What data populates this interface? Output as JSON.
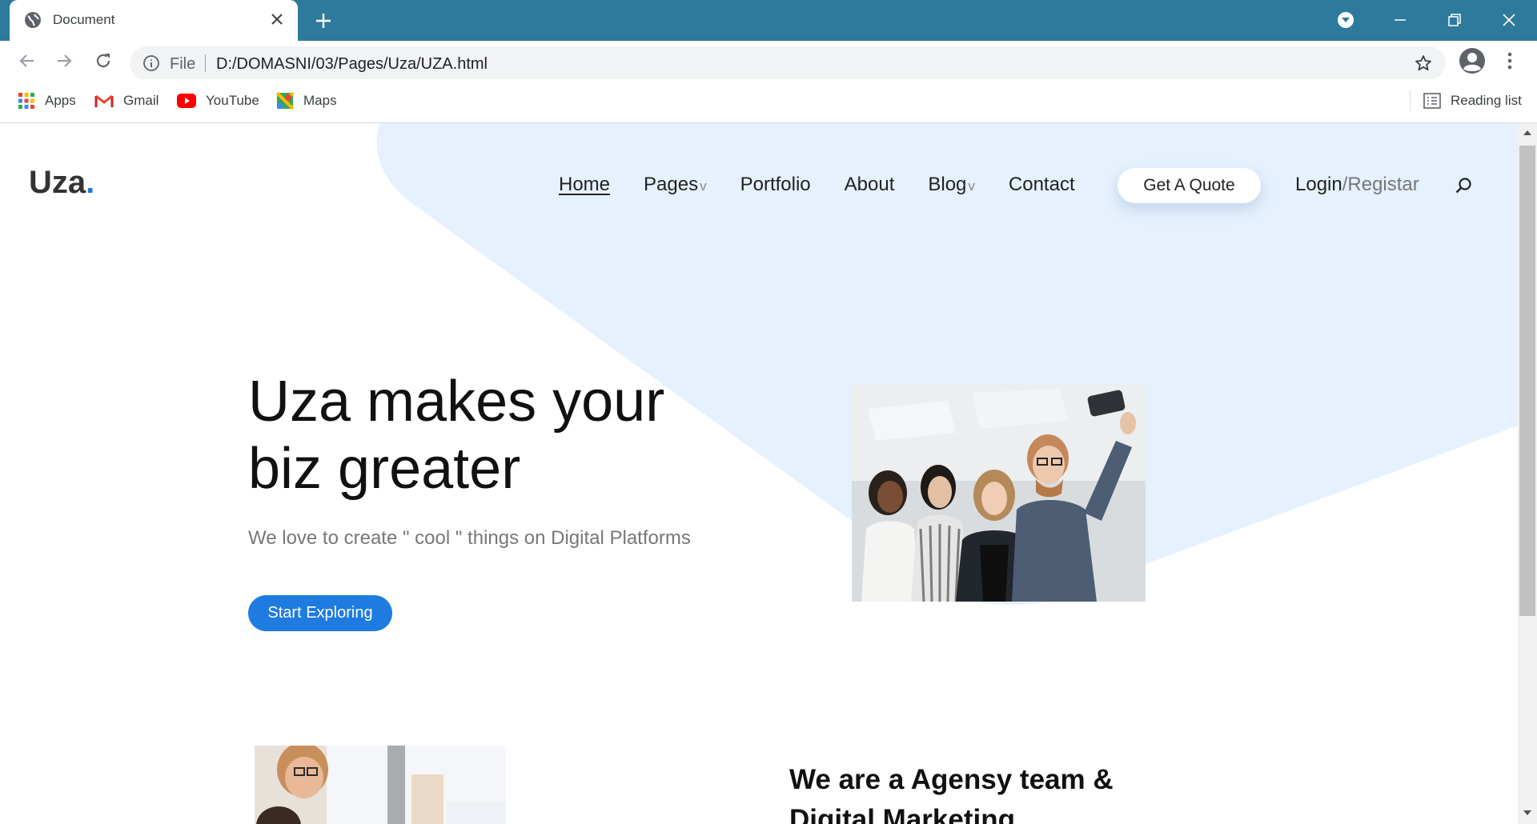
{
  "browser": {
    "tab_title": "Document",
    "address_scheme": "File",
    "address_url": "D:/DOMASNI/03/Pages/Uza/UZA.html",
    "bookmarks": [
      {
        "label": "Apps",
        "icon": "apps-grid-icon"
      },
      {
        "label": "Gmail",
        "icon": "gmail-icon"
      },
      {
        "label": "YouTube",
        "icon": "youtube-icon"
      },
      {
        "label": "Maps",
        "icon": "maps-icon"
      }
    ],
    "reading_list": "Reading list",
    "tab_bar_color": "#2d7a9c"
  },
  "site": {
    "logo": "Uza",
    "logo_dot": ".",
    "nav": {
      "home": "Home",
      "pages": "Pages",
      "portfolio": "Portfolio",
      "about": "About",
      "blog": "Blog",
      "contact": "Contact",
      "caret": "v"
    },
    "quote_button": "Get A Quote",
    "login": "Login",
    "register": "/Registar",
    "accent_color": "#1e7be0",
    "shape_color": "#e6f1fd"
  },
  "hero": {
    "title_line1": "Uza makes your",
    "title_line2": "biz greater",
    "subtitle": "We love to create \" cool \" things on Digital Platforms",
    "cta": "Start Exploring"
  },
  "about": {
    "title_line1": "We are a Agensy team &",
    "title_line2": "Digital Marketing"
  }
}
